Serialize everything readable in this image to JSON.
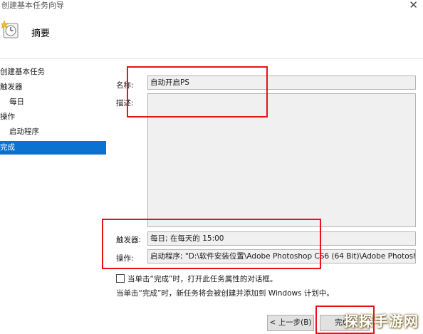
{
  "window": {
    "title": "创建基本任务向导",
    "close_glyph": "✕"
  },
  "header": {
    "title": "摘要",
    "icon": "task-scheduler-clock-icon"
  },
  "nav": {
    "items": [
      {
        "label": "创建基本任务"
      },
      {
        "label": "触发器"
      },
      {
        "label": "每日"
      },
      {
        "label": "操作"
      },
      {
        "label": "启动程序"
      },
      {
        "label": "完成"
      }
    ],
    "selected": "完成"
  },
  "form": {
    "name_label": "名称:",
    "name_value": "自动开启PS",
    "desc_label": "描述:",
    "desc_value": "",
    "trigger_label": "触发器:",
    "trigger_value": "每日; 在每天的 15:00",
    "action_label": "操作:",
    "action_value": "启动程序; \"D:\\软件安装位置\\Adobe Photoshop CS6 (64 Bit)\\Adobe Photosh"
  },
  "options": {
    "open_properties_label": "当单击“完成”时，打开此任务属性的对话框。",
    "open_properties_checked": false,
    "finish_note": "当单击“完成”时，新任务将会被创建并添加到 Windows 计划中。"
  },
  "buttons": {
    "back_label": "< 上一步(B)",
    "finish_label": "完成"
  },
  "colors": {
    "highlight": "#e3141c",
    "selection": "#0a72d1"
  },
  "watermark": "探探手游网"
}
